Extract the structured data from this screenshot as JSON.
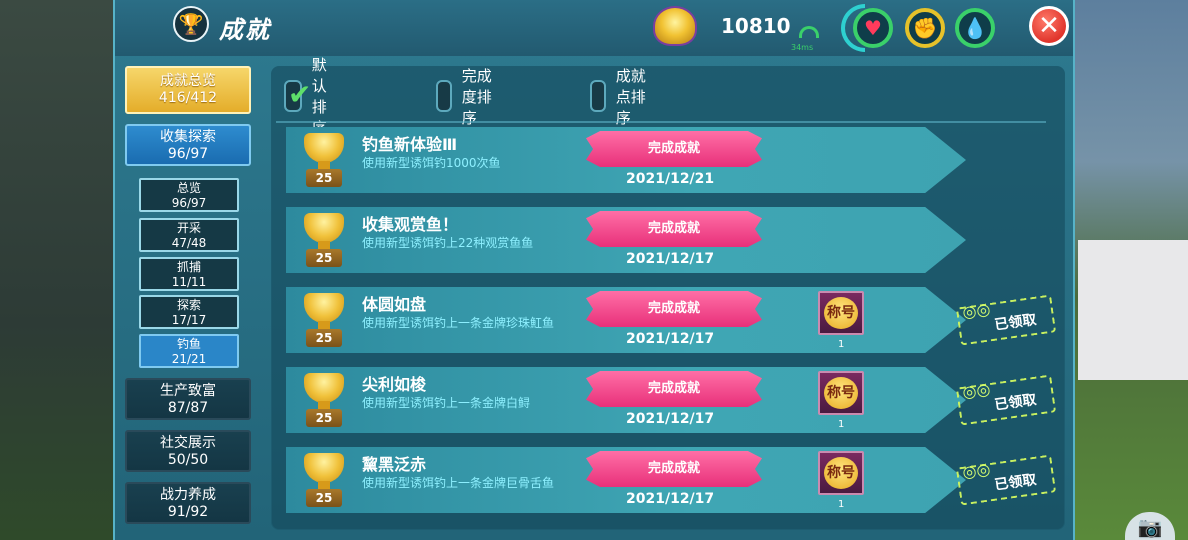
{
  "header": {
    "title": "成就",
    "coin_value": "10810",
    "ping": "34ms"
  },
  "sidebar": {
    "overview": {
      "label": "成就总览",
      "count": "416/412"
    },
    "categories": [
      {
        "label": "收集探索",
        "count": "96/97",
        "active": true
      },
      {
        "label": "生产致富",
        "count": "87/87",
        "active": false
      },
      {
        "label": "社交展示",
        "count": "50/50",
        "active": false
      },
      {
        "label": "战力养成",
        "count": "91/92",
        "active": false
      }
    ],
    "sub_items": [
      {
        "label": "总览",
        "count": "96/97",
        "selected": false
      },
      {
        "label": "开采",
        "count": "47/48",
        "selected": false
      },
      {
        "label": "抓捕",
        "count": "11/11",
        "selected": false
      },
      {
        "label": "探索",
        "count": "17/17",
        "selected": false
      },
      {
        "label": "钓鱼",
        "count": "21/21",
        "selected": true
      }
    ]
  },
  "sort": {
    "options": [
      {
        "label": "默认排序",
        "checked": true
      },
      {
        "label": "完成度排序",
        "checked": false
      },
      {
        "label": "成就点排序",
        "checked": false
      }
    ]
  },
  "achievements": [
    {
      "name": "钓鱼新体验Ⅲ",
      "desc": "使用新型诱饵钓1000次鱼",
      "points": "25",
      "status": "完成成就",
      "date": "2021/12/21",
      "has_title": false,
      "title_label": "",
      "title_count": "",
      "claimed_label": ""
    },
    {
      "name": "收集观赏鱼！",
      "desc": "使用新型诱饵钓上22种观赏鱼鱼",
      "points": "25",
      "status": "完成成就",
      "date": "2021/12/17",
      "has_title": false,
      "title_label": "",
      "title_count": "",
      "claimed_label": ""
    },
    {
      "name": "体圆如盘",
      "desc": "使用新型诱饵钓上一条金牌珍珠魟鱼",
      "points": "25",
      "status": "完成成就",
      "date": "2021/12/17",
      "has_title": true,
      "title_label": "称号",
      "title_count": "1",
      "claimed_label": "已领取"
    },
    {
      "name": "尖利如梭",
      "desc": "使用新型诱饵钓上一条金牌白鲟",
      "points": "25",
      "status": "完成成就",
      "date": "2021/12/17",
      "has_title": true,
      "title_label": "称号",
      "title_count": "1",
      "claimed_label": "已领取"
    },
    {
      "name": "黧黑泛赤",
      "desc": "使用新型诱饵钓上一条金牌巨骨舌鱼",
      "points": "25",
      "status": "完成成就",
      "date": "2021/12/17",
      "has_title": true,
      "title_label": "称号",
      "title_count": "1",
      "claimed_label": "已领取"
    }
  ],
  "colors": {
    "panel": "#2e7a90",
    "gold": "#e4ad2a",
    "active_blue": "#2a86c8",
    "ribbon_pink": "#e8307a",
    "desc_cyan": "#8ef0ff"
  }
}
